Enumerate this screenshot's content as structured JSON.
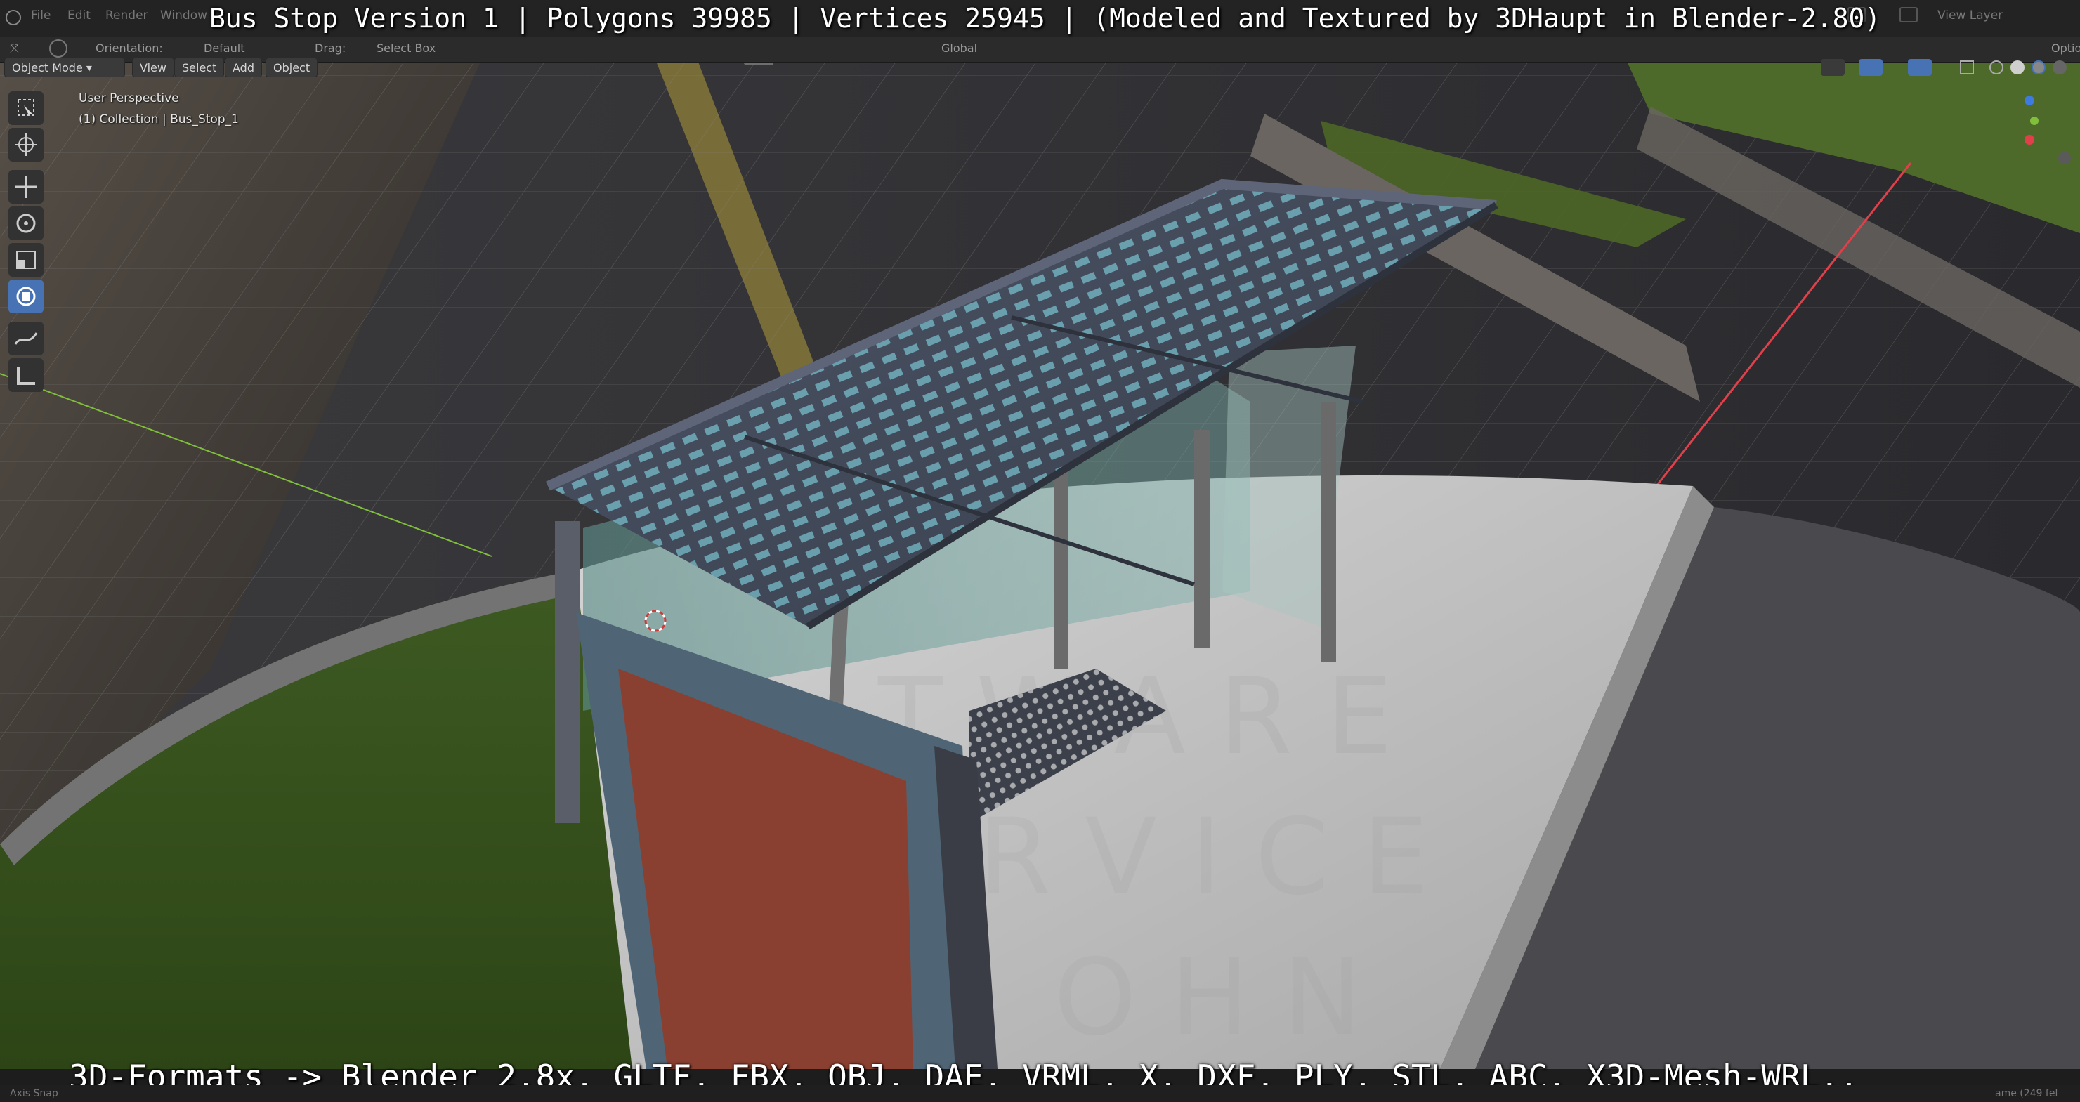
{
  "window": {
    "menus": [
      "File",
      "Edit",
      "Render",
      "Window"
    ],
    "right_label": "View Layer",
    "right_label2": "Optio"
  },
  "header": {
    "orientation_label": "Orientation:",
    "orientation_value": "Default",
    "drag_label": "Drag:",
    "drag_value": "Select Box",
    "transform_value": "Global"
  },
  "viewport_header": {
    "mode": "Object Mode",
    "menus": [
      "View",
      "Select",
      "Add",
      "Object"
    ]
  },
  "viewport_info": {
    "perspective": "User Perspective",
    "collection": "(1) Collection | Bus_Stop_1"
  },
  "overlay": {
    "title": "Bus Stop Version 1 | Polygons 39985 | Vertices 25945 | (Modeled and Textured by 3DHaupt in Blender-2.80)",
    "formats": "3D-Formats -> Blender 2.8x, GLTF, FBX, OBJ, DAE, VRML, X, DXF, PLY, STL, ABC, X3D-Mesh-WRL.."
  },
  "statusbar": {
    "left": "Axis Snap",
    "right": "ame (249 fel"
  },
  "colors": {
    "accent": "#4772b3",
    "x_axis": "#e0404a",
    "y_axis": "#7fbf3a",
    "z_axis": "#3d7be0"
  }
}
